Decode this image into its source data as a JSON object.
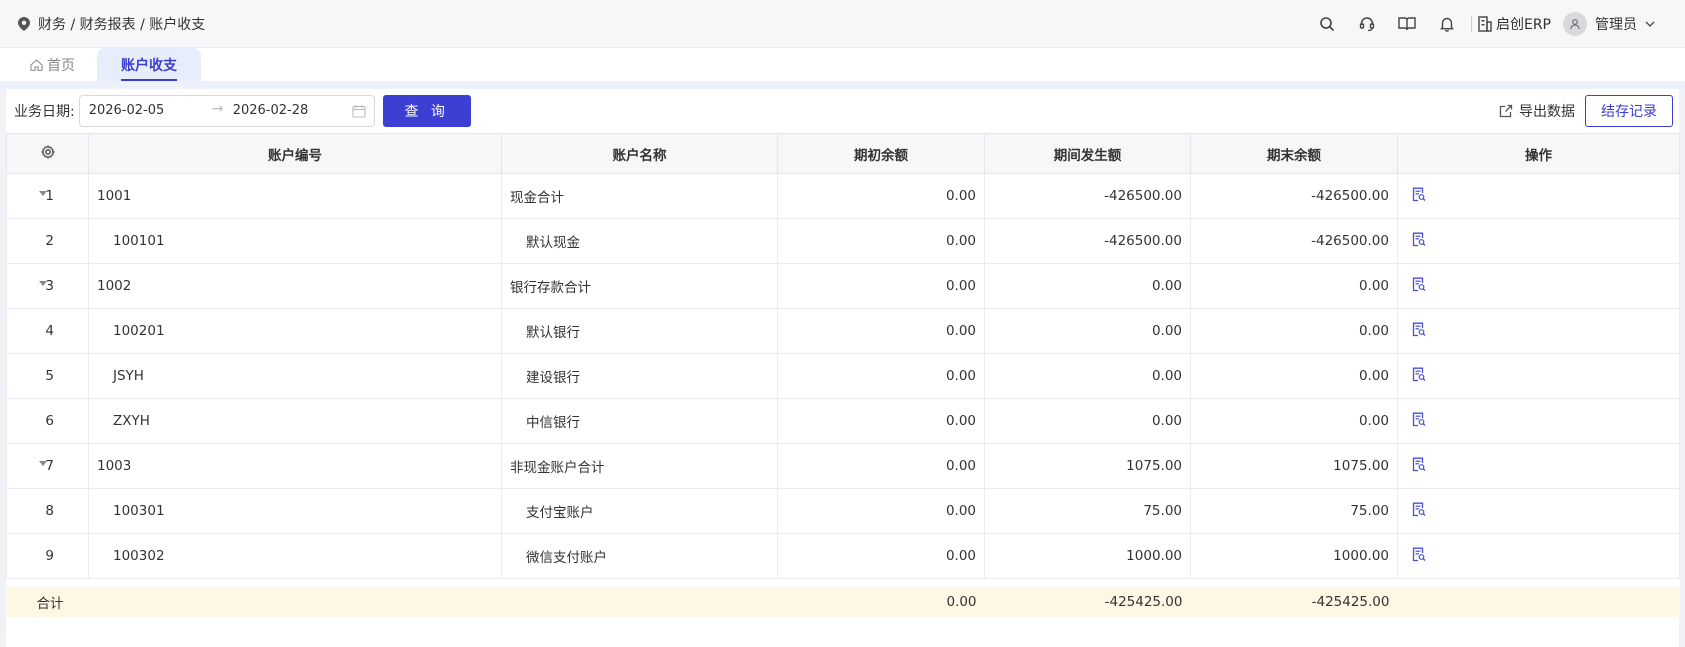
{
  "breadcrumb": "财务 / 财务报表 / 账户收支",
  "header": {
    "brand": "启创ERP",
    "user": "管理员"
  },
  "tabs": [
    {
      "label": "首页"
    },
    {
      "label": "账户收支"
    }
  ],
  "filter": {
    "label": "业务日期:",
    "start": "2026-02-05",
    "arrow": "→",
    "end": "2026-02-28",
    "query": "查 询"
  },
  "actions": {
    "export": "导出数据",
    "record": "结存记录"
  },
  "table": {
    "columns": [
      "账户编号",
      "账户名称",
      "期初余额",
      "期间发生额",
      "期末余额",
      "操作"
    ],
    "rows": [
      {
        "index": "1",
        "code": "1001",
        "name": "现金合计",
        "opening": "0.00",
        "period": "-426500.00",
        "closing": "-426500.00"
      },
      {
        "index": "2",
        "code": "100101",
        "name": "默认现金",
        "opening": "0.00",
        "period": "-426500.00",
        "closing": "-426500.00"
      },
      {
        "index": "3",
        "code": "1002",
        "name": "银行存款合计",
        "opening": "0.00",
        "period": "0.00",
        "closing": "0.00"
      },
      {
        "index": "4",
        "code": "100201",
        "name": "默认银行",
        "opening": "0.00",
        "period": "0.00",
        "closing": "0.00"
      },
      {
        "index": "5",
        "code": "JSYH",
        "name": "建设银行",
        "opening": "0.00",
        "period": "0.00",
        "closing": "0.00"
      },
      {
        "index": "6",
        "code": "ZXYH",
        "name": "中信银行",
        "opening": "0.00",
        "period": "0.00",
        "closing": "0.00"
      },
      {
        "index": "7",
        "code": "1003",
        "name": "非现金账户合计",
        "opening": "0.00",
        "period": "1075.00",
        "closing": "1075.00"
      },
      {
        "index": "8",
        "code": "100301",
        "name": "支付宝账户",
        "opening": "0.00",
        "period": "75.00",
        "closing": "75.00"
      },
      {
        "index": "9",
        "code": "100302",
        "name": "微信支付账户",
        "opening": "0.00",
        "period": "1000.00",
        "closing": "1000.00"
      }
    ],
    "total": {
      "label": "合计",
      "opening": "0.00",
      "period": "-425425.00",
      "closing": "-425425.00"
    }
  },
  "colors": {
    "accent": "#3d3fd4",
    "total_bg": "#fdf8e4"
  }
}
